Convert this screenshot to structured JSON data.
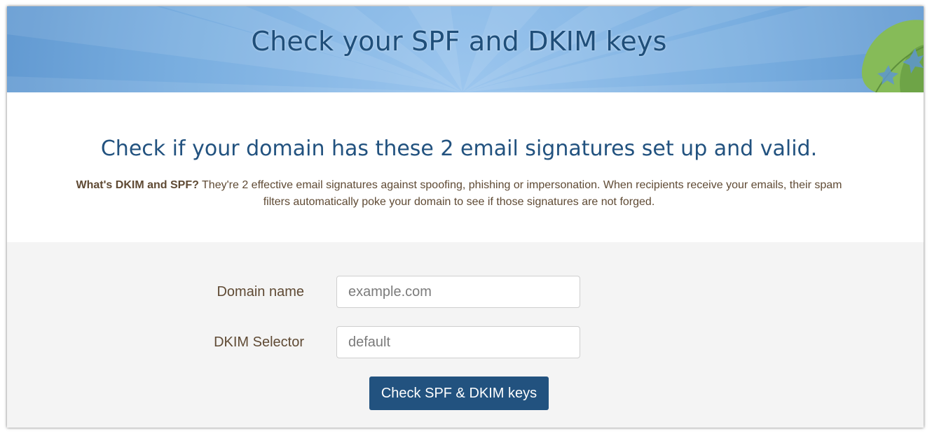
{
  "banner": {
    "title": "Check your SPF and DKIM keys"
  },
  "intro": {
    "headline": "Check if your domain has these 2 email signatures set up and valid.",
    "desc_bold": "What's DKIM and SPF?",
    "desc_text": " They're 2 effective email signatures against spoofing, phishing or impersonation. When recipients receive your emails, their spam filters automatically poke your domain to see if those signatures are not forged."
  },
  "form": {
    "domain_label": "Domain name",
    "domain_placeholder": "example.com",
    "domain_value": "",
    "selector_label": "DKIM Selector",
    "selector_placeholder": "default",
    "selector_value": "",
    "submit_label": "Check SPF & DKIM keys"
  },
  "colors": {
    "brand_dark_blue": "#22527f",
    "banner_blue": "#6fa6d9",
    "text_brown": "#5f4a34",
    "form_background": "#f4f4f4",
    "leaf_green": "#8cbf5e"
  },
  "icons": {
    "banner_decoration": "leaf-icon"
  }
}
